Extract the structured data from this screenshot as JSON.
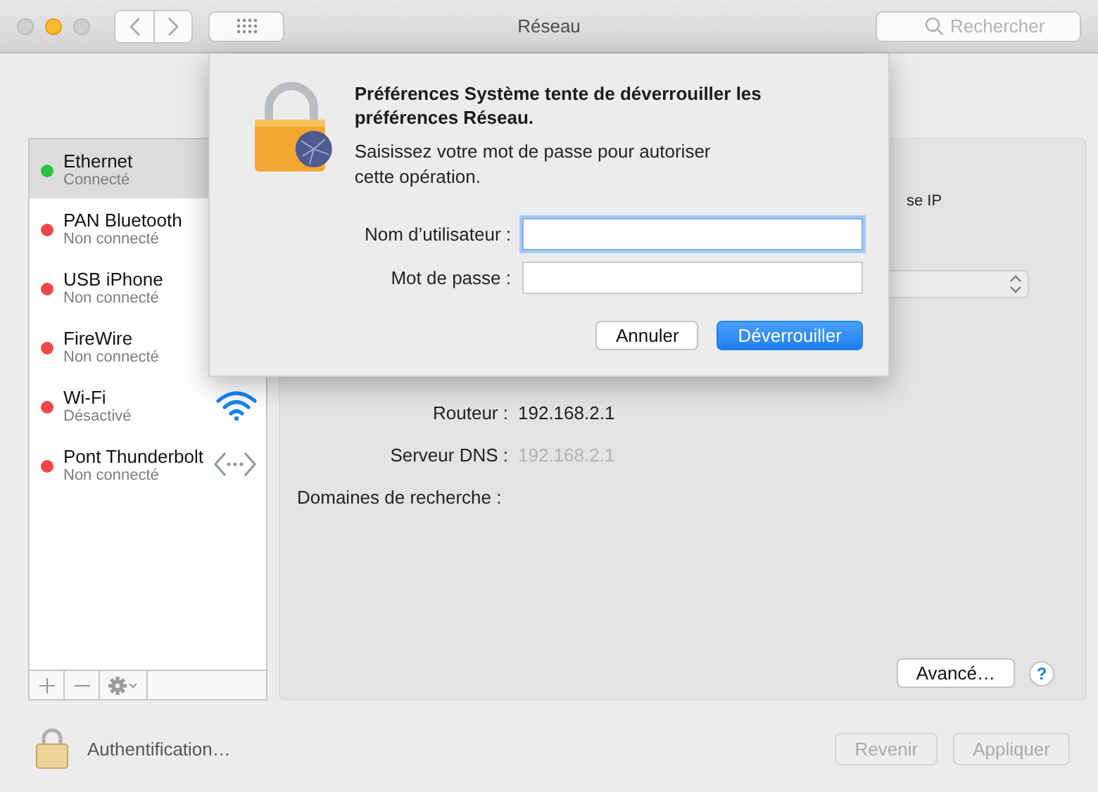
{
  "window": {
    "title": "Réseau",
    "search_placeholder": "Rechercher"
  },
  "services": [
    {
      "name": "Ethernet",
      "status": "Connecté",
      "color": "#2ac340",
      "selected": true,
      "kind": "plain"
    },
    {
      "name": "PAN Bluetooth",
      "status": "Non connecté",
      "color": "#f2474a",
      "selected": false,
      "kind": "plain"
    },
    {
      "name": "USB iPhone",
      "status": "Non connecté",
      "color": "#f2474a",
      "selected": false,
      "kind": "plain"
    },
    {
      "name": "FireWire",
      "status": "Non connecté",
      "color": "#f2474a",
      "selected": false,
      "kind": "plain"
    },
    {
      "name": "Wi-Fi",
      "status": "Désactivé",
      "color": "#f2474a",
      "selected": false,
      "kind": "wifi"
    },
    {
      "name": "Pont Thunderbolt",
      "status": "Non connecté",
      "color": "#f2474a",
      "selected": false,
      "kind": "bridge"
    }
  ],
  "detail": {
    "partial_label": "se IP",
    "fields": [
      {
        "label": "Routeur :",
        "value": "192.168.2.1",
        "dimmed": false
      },
      {
        "label": "Serveur DNS :",
        "value": "192.168.2.1",
        "dimmed": true
      },
      {
        "label": "Domaines de recherche :"
      }
    ],
    "advanced_button": "Avancé…",
    "help_button": "?"
  },
  "footer": {
    "lock_label": "Authentification…",
    "buttons": [
      {
        "label": "Revenir",
        "disabled": true
      },
      {
        "label": "Appliquer",
        "disabled": true
      }
    ]
  },
  "dialog": {
    "title": "Préférences Système tente de déverrouiller les préférences Réseau.",
    "message": "Saisissez votre mot de passe pour autoriser cette opération.",
    "fields": [
      {
        "label": "Nom d’utilisateur :",
        "focused": true
      },
      {
        "label": "Mot de passe :",
        "focused": false
      }
    ],
    "buttons": [
      {
        "label": "Annuler",
        "default": false
      },
      {
        "label": "Déverrouiller",
        "default": true
      }
    ]
  }
}
